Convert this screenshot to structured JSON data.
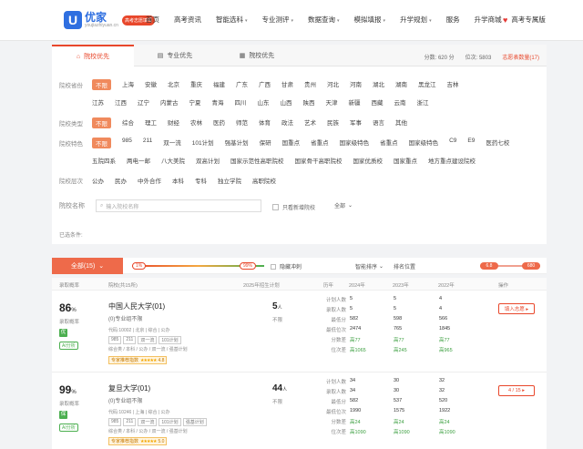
{
  "header": {
    "logo_mark": "U",
    "brand": "优家",
    "domain": "youjiazhiyuan.cn",
    "badge": "高考志愿填报",
    "nav": [
      {
        "label": "首页",
        "has_menu": false
      },
      {
        "label": "高考资讯",
        "has_menu": false
      },
      {
        "label": "智能选科",
        "has_menu": true
      },
      {
        "label": "专业测评",
        "has_menu": true
      },
      {
        "label": "数据查询",
        "has_menu": true
      },
      {
        "label": "模拟填报",
        "has_menu": true
      },
      {
        "label": "升学规划",
        "has_menu": true
      },
      {
        "label": "服务",
        "has_menu": false
      },
      {
        "label": "升学商城",
        "has_menu": false
      }
    ],
    "vip_label": "高考专属版"
  },
  "filter": {
    "tabs": [
      {
        "icon": "⌂",
        "label": "院校优先"
      },
      {
        "icon": "▤",
        "label": "专业优先"
      },
      {
        "icon": "▦",
        "label": "院校优先"
      }
    ],
    "right": {
      "score": "分数: 620 分",
      "rank": "位次: 5803",
      "plan": "志愿表数量(17)"
    },
    "region": {
      "label": "院校省份",
      "row1": [
        "不限",
        "上海",
        "安徽",
        "北京",
        "重庆",
        "福建",
        "广东",
        "广西",
        "甘肃",
        "贵州",
        "河北",
        "河南",
        "湖北",
        "湖南",
        "黑龙江",
        "吉林"
      ],
      "row2": [
        "江苏",
        "江西",
        "辽宁",
        "内蒙古",
        "宁夏",
        "青海",
        "四川",
        "山东",
        "山西",
        "陕西",
        "天津",
        "新疆",
        "西藏",
        "云南",
        "浙江"
      ]
    },
    "type": {
      "label": "院校类型",
      "options": [
        "不限",
        "综合",
        "理工",
        "财经",
        "农林",
        "医药",
        "师范",
        "体育",
        "政法",
        "艺术",
        "民族",
        "军事",
        "语言",
        "其他"
      ]
    },
    "feature": {
      "label": "院校特色",
      "row1": [
        "不限",
        "985",
        "211",
        "双一流",
        "101计划",
        "强基计划",
        "保研",
        "国重点",
        "省重点",
        "国家级特色",
        "省重点",
        "国家级特色",
        "C9",
        "E9",
        "医药七校"
      ],
      "row2": [
        "五院四系",
        "两电一邮",
        "八大美院",
        "双高计划",
        "国家示范性高职院校",
        "国家骨干高职院校",
        "国家优质校",
        "国家重点",
        "地方重点建设院校"
      ]
    },
    "level": {
      "label": "院校层次",
      "options": [
        "公办",
        "民办",
        "中外合作",
        "本科",
        "专科",
        "独立学院",
        "高职院校"
      ]
    },
    "search": {
      "label": "院校名称",
      "placeholder": "输入院校名称"
    },
    "new_toggle": "只看新增院校",
    "select_label": "全部",
    "selected_label": "已选条件:"
  },
  "toolbar": {
    "all_button": "全部(15)",
    "prob_low": "1%",
    "prob_high": "99%",
    "hide_low": "隐藏冲刺",
    "sort": "智能排序",
    "rank_label": "排名位置",
    "rank_low": "6.8",
    "rank_high": "680"
  },
  "table": {
    "headers": [
      "录取概率",
      "院校(共15所)",
      "2025年招生计划",
      "历年",
      "2024年",
      "2023年",
      "2022年",
      "操作"
    ],
    "rows": [
      {
        "prob": "86",
        "prob_label": "录取概率",
        "prob_tag": "优",
        "analysis_tag": "AI分析",
        "name": "中国人民大学(01)",
        "sub": "(0)专业组不限",
        "tags": [
          "985",
          "211",
          "双一流",
          "101计划"
        ],
        "info": "代码:10002 | 北京 | 综合 | 公办",
        "info2": "综合类 / 本科 / 公办 / 双一流 / 强基计划",
        "rating_label": "专家推荐指数",
        "rating_stars": "★★★★★",
        "rating_value": "4.8",
        "plan": "5",
        "plan_unit": "人",
        "plan_label": "不限",
        "stats": [
          {
            "label": "计划人数",
            "v24": "5",
            "v23": "5",
            "v22": "4"
          },
          {
            "label": "录取人数",
            "v24": "5",
            "v23": "5",
            "v22": "4"
          },
          {
            "label": "最低分",
            "v24": "582",
            "v23": "598",
            "v22": "566"
          },
          {
            "label": "最低位次",
            "v24": "2474",
            "v23": "765",
            "v22": "1845"
          },
          {
            "label": "分数差",
            "v24": "高77",
            "v23": "高77",
            "v22": "高77"
          },
          {
            "label": "位次差",
            "v24": "高1065",
            "v23": "高245",
            "v22": "高965"
          }
        ],
        "action": "填入志愿 ▸"
      },
      {
        "prob": "99",
        "prob_label": "录取概率",
        "prob_tag": "保",
        "analysis_tag": "AI分析",
        "name": "复旦大学(01)",
        "sub": "(0)专业组不限",
        "tags": [
          "985",
          "211",
          "双一流",
          "101计划",
          "强基计划"
        ],
        "info": "代码:10246 | 上海 | 综合 | 公办",
        "info2": "综合类 / 本科 / 公办 / 双一流 / 强基计划",
        "rating_label": "专家推荐指数",
        "rating_stars": "★★★★★",
        "rating_value": "5.0",
        "plan": "44",
        "plan_unit": "人",
        "plan_label": "不限",
        "stats": [
          {
            "label": "计划人数",
            "v24": "34",
            "v23": "30",
            "v22": "32"
          },
          {
            "label": "录取人数",
            "v24": "34",
            "v23": "30",
            "v22": "32"
          },
          {
            "label": "最低分",
            "v24": "582",
            "v23": "537",
            "v22": "520"
          },
          {
            "label": "最低位次",
            "v24": "1990",
            "v23": "1575",
            "v22": "1922"
          },
          {
            "label": "分数差",
            "v24": "高24",
            "v23": "高24",
            "v22": "高24"
          },
          {
            "label": "位次差",
            "v24": "高1090",
            "v23": "高1090",
            "v22": "高1090"
          }
        ],
        "action": "4 / 15 ▸"
      }
    ]
  }
}
